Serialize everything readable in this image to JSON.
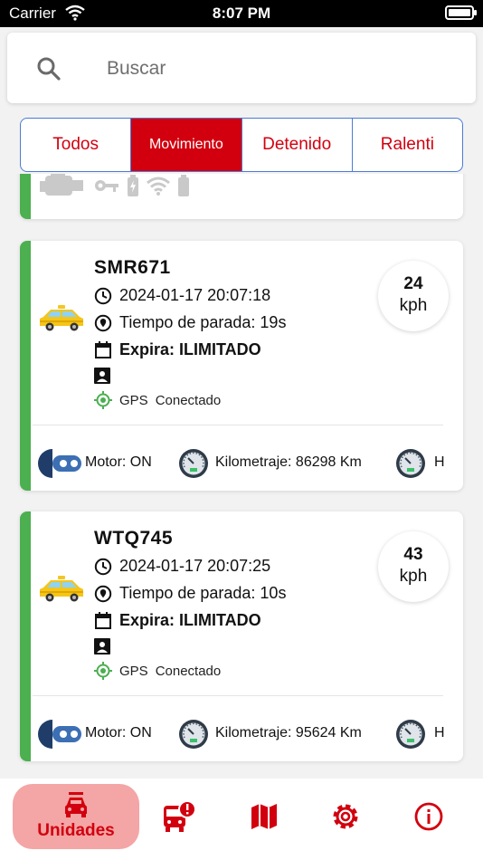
{
  "status_bar": {
    "carrier": "Carrier",
    "time": "8:07 PM"
  },
  "search": {
    "placeholder": "Buscar"
  },
  "filters": [
    {
      "label": "Todos",
      "active": false
    },
    {
      "label": "Movimiento",
      "active": true
    },
    {
      "label": "Detenido",
      "active": false
    },
    {
      "label": "Ralenti",
      "active": false
    }
  ],
  "vehicles": [
    {
      "plate": "SMR671",
      "datetime": "2024-01-17 20:07:18",
      "stop_time": "Tiempo de parada: 19s",
      "expires": "Expira: ILIMITADO",
      "gps_label": "GPS",
      "gps_status": "Conectado",
      "speed": "24",
      "speed_unit": "kph",
      "motor": "Motor: ON",
      "odometer": "Kilometraje:  86298 Km",
      "extra": "H"
    },
    {
      "plate": "WTQ745",
      "datetime": "2024-01-17 20:07:25",
      "stop_time": "Tiempo de parada: 10s",
      "expires": "Expira: ILIMITADO",
      "gps_label": "GPS",
      "gps_status": "Conectado",
      "speed": "43",
      "speed_unit": "kph",
      "motor": "Motor: ON",
      "odometer": "Kilometraje:  95624 Km",
      "extra": "H"
    }
  ],
  "nav": {
    "active_label": "Unidades"
  },
  "colors": {
    "accent": "#d2000f",
    "status_green": "#4caf50",
    "segment_border": "#4b7bd6",
    "active_tab_bg": "#f4a5a5"
  },
  "icons": [
    "search-icon",
    "engine-icon",
    "key-icon",
    "battery-icon",
    "wifi-icon",
    "clock-icon",
    "location-pin-icon",
    "calendar-icon",
    "id-card-icon",
    "gps-target-icon",
    "ignition-key-icon",
    "gauge-icon",
    "car-icon",
    "bus-alert-icon",
    "map-icon",
    "gear-icon",
    "info-icon"
  ]
}
